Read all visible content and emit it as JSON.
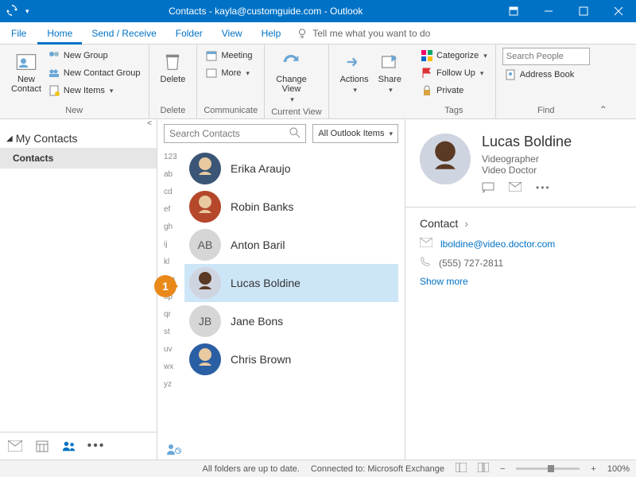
{
  "title": "Contacts - kayla@customguide.com - Outlook",
  "menu": {
    "file": "File",
    "home": "Home",
    "send_receive": "Send / Receive",
    "folder": "Folder",
    "view": "View",
    "help": "Help",
    "tellme": "Tell me what you want to do"
  },
  "ribbon": {
    "new_contact": "New\nContact",
    "new_group": "New Group",
    "new_contact_group": "New Contact Group",
    "new_items": "New Items",
    "group_new": "New",
    "delete": "Delete",
    "group_delete": "Delete",
    "meeting": "Meeting",
    "more": "More",
    "group_communicate": "Communicate",
    "change_view": "Change\nView",
    "group_currentview": "Current View",
    "actions": "Actions",
    "share": "Share",
    "categorize": "Categorize",
    "follow_up": "Follow Up",
    "private": "Private",
    "group_tags": "Tags",
    "search_placeholder": "Search People",
    "address_book": "Address Book",
    "group_find": "Find"
  },
  "nav": {
    "header": "My Contacts",
    "item1": "Contacts"
  },
  "list": {
    "search_placeholder": "Search Contacts",
    "filter": "All Outlook Items",
    "alpha": [
      "123",
      "ab",
      "cd",
      "ef",
      "gh",
      "ij",
      "kl",
      "mn",
      "op",
      "qr",
      "st",
      "uv",
      "wx",
      "yz"
    ],
    "rows": [
      {
        "name": "Erika Araujo",
        "initials": "",
        "skin": "#e8c9a0",
        "shirt": "#3b5576"
      },
      {
        "name": "Robin Banks",
        "initials": "",
        "skin": "#e8c9a0",
        "shirt": "#b5472a"
      },
      {
        "name": "Anton Baril",
        "initials": "AB",
        "skin": "",
        "shirt": ""
      },
      {
        "name": "Lucas Boldine",
        "initials": "",
        "skin": "#5a3a24",
        "shirt": "#cfd5e0"
      },
      {
        "name": "Jane Bons",
        "initials": "JB",
        "skin": "",
        "shirt": ""
      },
      {
        "name": "Chris Brown",
        "initials": "",
        "skin": "#e8c9a0",
        "shirt": "#2b5fa3"
      }
    ],
    "callout": "1"
  },
  "reading": {
    "name": "Lucas Boldine",
    "job": "Videographer",
    "company": "Video Doctor",
    "section": "Contact",
    "email": "lboldine@video.doctor.com",
    "phone": "(555) 727-2811",
    "showmore": "Show more"
  },
  "status": {
    "msg1": "All folders are up to date.",
    "msg2": "Connected to: Microsoft Exchange",
    "zoom": "100%"
  }
}
